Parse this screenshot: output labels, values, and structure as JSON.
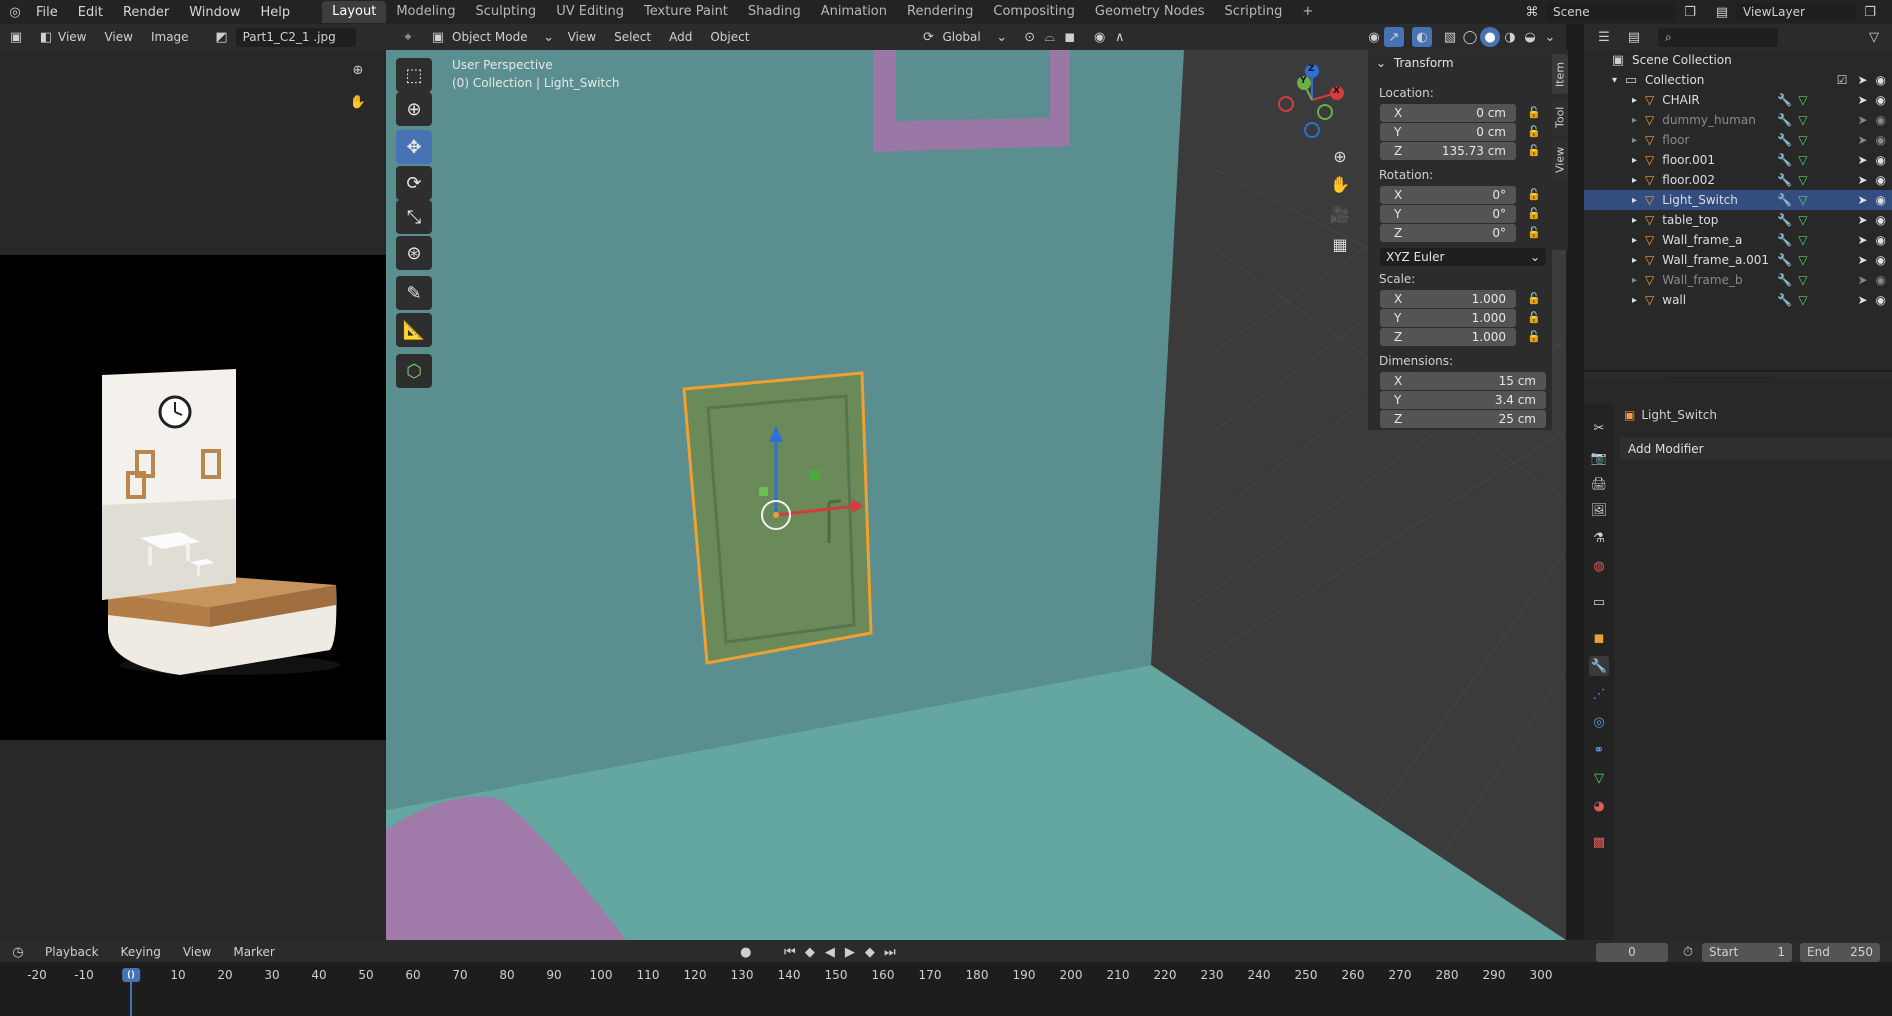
{
  "topbar": {
    "menus": [
      "File",
      "Edit",
      "Render",
      "Window",
      "Help"
    ],
    "workspaces": [
      "Layout",
      "Modeling",
      "Sculpting",
      "UV Editing",
      "Texture Paint",
      "Shading",
      "Animation",
      "Rendering",
      "Compositing",
      "Geometry Nodes",
      "Scripting"
    ],
    "active_workspace": "Layout",
    "add_tab": "+",
    "scene_name": "Scene",
    "view_layer": "ViewLayer"
  },
  "image_editor": {
    "menus": [
      "View",
      "View",
      "Image"
    ],
    "image_name": "Part1_C2_1 .jpg"
  },
  "viewport": {
    "mode": "Object Mode",
    "menus": [
      "View",
      "Select",
      "Add",
      "Object"
    ],
    "orientation": "Global",
    "overlay_title": "User Perspective",
    "overlay_sub": "(0) Collection | Light_Switch",
    "gizmo_axes": {
      "x": "X",
      "y": "Y",
      "z": "Z"
    }
  },
  "n_panel": {
    "section": "Transform",
    "location_label": "Location:",
    "location": [
      {
        "axis": "X",
        "value": "0 cm"
      },
      {
        "axis": "Y",
        "value": "0 cm"
      },
      {
        "axis": "Z",
        "value": "135.73 cm"
      }
    ],
    "rotation_label": "Rotation:",
    "rotation": [
      {
        "axis": "X",
        "value": "0°"
      },
      {
        "axis": "Y",
        "value": "0°"
      },
      {
        "axis": "Z",
        "value": "0°"
      }
    ],
    "rotation_mode": "XYZ Euler",
    "scale_label": "Scale:",
    "scale": [
      {
        "axis": "X",
        "value": "1.000"
      },
      {
        "axis": "Y",
        "value": "1.000"
      },
      {
        "axis": "Z",
        "value": "1.000"
      }
    ],
    "dimensions_label": "Dimensions:",
    "dimensions": [
      {
        "axis": "X",
        "value": "15 cm"
      },
      {
        "axis": "Y",
        "value": "3.4 cm"
      },
      {
        "axis": "Z",
        "value": "25 cm"
      }
    ],
    "tabs": [
      "Item",
      "Tool",
      "View"
    ]
  },
  "outliner": {
    "scene_collection": "Scene Collection",
    "collection": "Collection",
    "items": [
      {
        "name": "CHAIR",
        "dim": false,
        "selected": false
      },
      {
        "name": "dummy_human",
        "dim": true,
        "selected": false
      },
      {
        "name": "floor",
        "dim": true,
        "selected": false
      },
      {
        "name": "floor.001",
        "dim": false,
        "selected": false
      },
      {
        "name": "floor.002",
        "dim": false,
        "selected": false
      },
      {
        "name": "Light_Switch",
        "dim": false,
        "selected": true
      },
      {
        "name": "table_top",
        "dim": false,
        "selected": false
      },
      {
        "name": "Wall_frame_a",
        "dim": false,
        "selected": false
      },
      {
        "name": "Wall_frame_a.001",
        "dim": false,
        "selected": false
      },
      {
        "name": "Wall_frame_b",
        "dim": true,
        "selected": false
      },
      {
        "name": "wall",
        "dim": false,
        "selected": false
      }
    ]
  },
  "properties": {
    "object_name": "Light_Switch",
    "add_modifier": "Add Modifier"
  },
  "timeline": {
    "menus": [
      "Playback",
      "Keying",
      "View",
      "Marker"
    ],
    "current_frame": "0",
    "start_label": "Start",
    "start": "1",
    "end_label": "End",
    "end": "250",
    "ruler": [
      "-20",
      "-10",
      "0",
      "10",
      "20",
      "30",
      "40",
      "50",
      "60",
      "70",
      "80",
      "90",
      "100",
      "110",
      "120",
      "130",
      "140",
      "150",
      "160",
      "170",
      "180",
      "190",
      "200",
      "210",
      "220",
      "230",
      "240",
      "250",
      "260",
      "270",
      "280",
      "290",
      "300"
    ]
  },
  "colors": {
    "accent": "#4772b3",
    "selection_outline": "#f0a030",
    "wall": "#5b8f8f",
    "floor": "#63a7a0",
    "object": "#6b8a5a",
    "purple": "#a07aa8"
  }
}
